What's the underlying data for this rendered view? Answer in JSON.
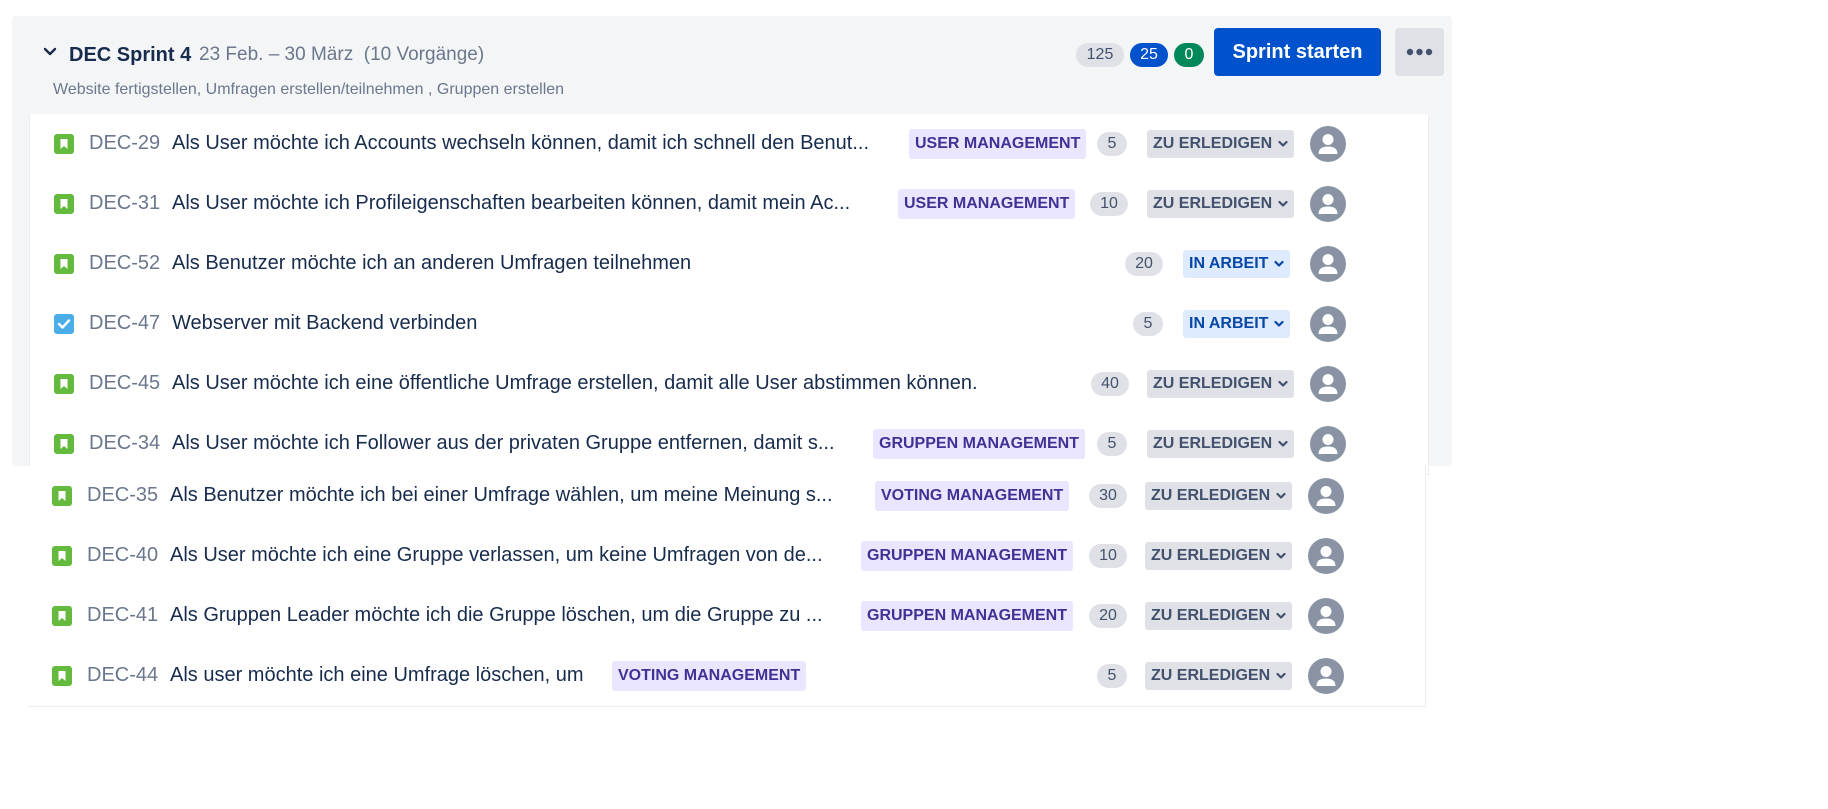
{
  "sprint": {
    "name": "DEC Sprint 4",
    "dates": "23 Feb. – 30 März  (10 Vorgänge)",
    "goal": "Website fertigstellen, Umfragen erstellen/teilnehmen , Gruppen erstellen",
    "points_todo": "125",
    "points_in_progress": "25",
    "points_done": "0",
    "start_button": "Sprint starten",
    "more_icon": "more-horizontal-icon",
    "collapse_icon": "chevron-down-icon"
  },
  "colors": {
    "primary": "#0052cc",
    "done": "#00875a",
    "story": "#63ba3c",
    "task": "#4bade8",
    "epic_bg": "#eae6ff",
    "epic_text": "#403294",
    "avatar": "#8993a4"
  },
  "issues": [
    {
      "key": "DEC-29",
      "type": "story",
      "summary": "Als User möchte ich Accounts wechseln können, damit ich schnell den Benut...",
      "epic": "USER MANAGEMENT",
      "estimate": "5",
      "status": "ZU ERLEDIGEN"
    },
    {
      "key": "DEC-31",
      "type": "story",
      "summary": "Als User möchte ich Profileigenschaften bearbeiten können, damit mein Ac...",
      "epic": "USER MANAGEMENT",
      "estimate": "10",
      "status": "ZU ERLEDIGEN"
    },
    {
      "key": "DEC-52",
      "type": "story",
      "summary": "Als Benutzer möchte ich an anderen Umfragen teilnehmen",
      "epic": "",
      "estimate": "20",
      "status": "IN ARBEIT"
    },
    {
      "key": "DEC-47",
      "type": "task",
      "summary": "Webserver mit Backend verbinden",
      "epic": "",
      "estimate": "5",
      "status": "IN ARBEIT"
    },
    {
      "key": "DEC-45",
      "type": "story",
      "summary": "Als User möchte ich eine öffentliche Umfrage erstellen, damit alle User abstimmen können.",
      "epic": "",
      "estimate": "40",
      "status": "ZU ERLEDIGEN"
    },
    {
      "key": "DEC-34",
      "type": "story",
      "summary": "Als User möchte ich Follower aus der privaten Gruppe entfernen, damit s...",
      "epic": "GRUPPEN MANAGEMENT",
      "estimate": "5",
      "status": "ZU ERLEDIGEN"
    },
    {
      "key": "DEC-35",
      "type": "story",
      "summary": "Als Benutzer möchte ich bei einer Umfrage wählen, um meine Meinung s...",
      "epic": "VOTING MANAGEMENT",
      "estimate": "30",
      "status": "ZU ERLEDIGEN"
    },
    {
      "key": "DEC-40",
      "type": "story",
      "summary": "Als User möchte ich eine Gruppe verlassen, um keine Umfragen von de...",
      "epic": "GRUPPEN MANAGEMENT",
      "estimate": "10",
      "status": "ZU ERLEDIGEN"
    },
    {
      "key": "DEC-41",
      "type": "story",
      "summary": "Als Gruppen Leader möchte ich die Gruppe löschen, um die Gruppe zu ...",
      "epic": "GRUPPEN MANAGEMENT",
      "estimate": "20",
      "status": "ZU ERLEDIGEN"
    },
    {
      "key": "DEC-44",
      "type": "story",
      "summary": "Als user möchte ich eine Umfrage löschen, um",
      "epic": "VOTING MANAGEMENT",
      "estimate": "5",
      "status": "ZU ERLEDIGEN"
    }
  ]
}
